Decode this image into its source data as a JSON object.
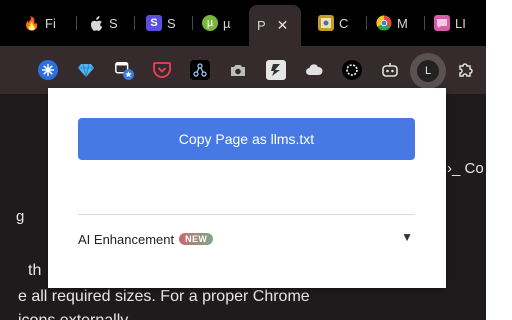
{
  "tabs": [
    {
      "icon": "fire-icon",
      "glyph": "🔥",
      "label": "Fi",
      "color": "#000000"
    },
    {
      "icon": "apple-icon",
      "glyph": "",
      "label": "S",
      "color": "#555555"
    },
    {
      "icon": "s-icon",
      "glyph": "S",
      "label": "S",
      "color": "#5b4ee0"
    },
    {
      "icon": "utorrent-icon",
      "glyph": "µ",
      "label": "µ",
      "color": "#78b83a"
    },
    {
      "icon": "doc-icon",
      "glyph": "",
      "label": "C",
      "color": "#c59a2c"
    },
    {
      "icon": "chrome-icon",
      "glyph": "",
      "label": "M",
      "color": "#e34c3d"
    },
    {
      "icon": "chat-icon",
      "glyph": "",
      "label": "LI",
      "color": "#d65ca8"
    }
  ],
  "active_tab": {
    "label": "P",
    "close_glyph": "✕"
  },
  "profile": {
    "letter": "L"
  },
  "page_text": {
    "right_fragment": "›_  Co",
    "line1": "g",
    "line2": "th",
    "line3": "e all required sizes. For a proper Chrome",
    "line4": "icons externally"
  },
  "popup": {
    "copy_button": "Copy Page as llms.txt",
    "ai_label": "AI Enhancement",
    "badge": "NEW",
    "expand_glyph": "▼"
  },
  "colors": {
    "accent": "#4779e4",
    "toolbar": "#352b2d",
    "tabstrip": "#000000"
  }
}
